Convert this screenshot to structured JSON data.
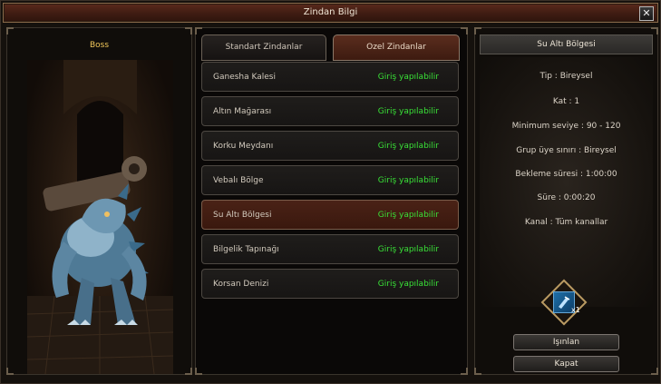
{
  "window": {
    "title": "Zindan Bilgi"
  },
  "boss": {
    "label": "Boss"
  },
  "tabs": [
    {
      "label": "Standart Zindanlar",
      "active": false
    },
    {
      "label": "Ozel Zindanlar",
      "active": true
    }
  ],
  "dungeons": [
    {
      "name": "Ganesha Kalesi",
      "status": "Giriş yapılabilir",
      "selected": false
    },
    {
      "name": "Altın Mağarası",
      "status": "Giriş yapılabilir",
      "selected": false
    },
    {
      "name": "Korku Meydanı",
      "status": "Giriş yapılabilir",
      "selected": false
    },
    {
      "name": "Vebalı Bölge",
      "status": "Giriş yapılabilir",
      "selected": false
    },
    {
      "name": "Su Altı Bölgesi",
      "status": "Giriş yapılabilir",
      "selected": true
    },
    {
      "name": "Bilgelik Tapınağı",
      "status": "Giriş yapılabilir",
      "selected": false
    },
    {
      "name": "Korsan Denizi",
      "status": "Giriş yapılabilir",
      "selected": false
    }
  ],
  "info": {
    "header": "Su Altı Bölgesi",
    "type": "Tip : Bireysel",
    "floor": "Kat : 1",
    "min_level": "Minimum seviye : 90 - 120",
    "group_limit": "Grup üye sınırı : Bireysel",
    "cooldown": "Bekleme süresi : 1:00:00",
    "duration": "Süre : 0:00:20",
    "channel": "Kanal : Tüm kanallar"
  },
  "reward": {
    "count": "x1",
    "icon": "blue-scroll-icon"
  },
  "buttons": {
    "teleport": "Işınlan",
    "close": "Kapat"
  },
  "colors": {
    "status_green": "#39e037",
    "boss_label": "#f1c75a",
    "active_tab": "#5a2d1e",
    "selected_row": "#4a2216"
  }
}
